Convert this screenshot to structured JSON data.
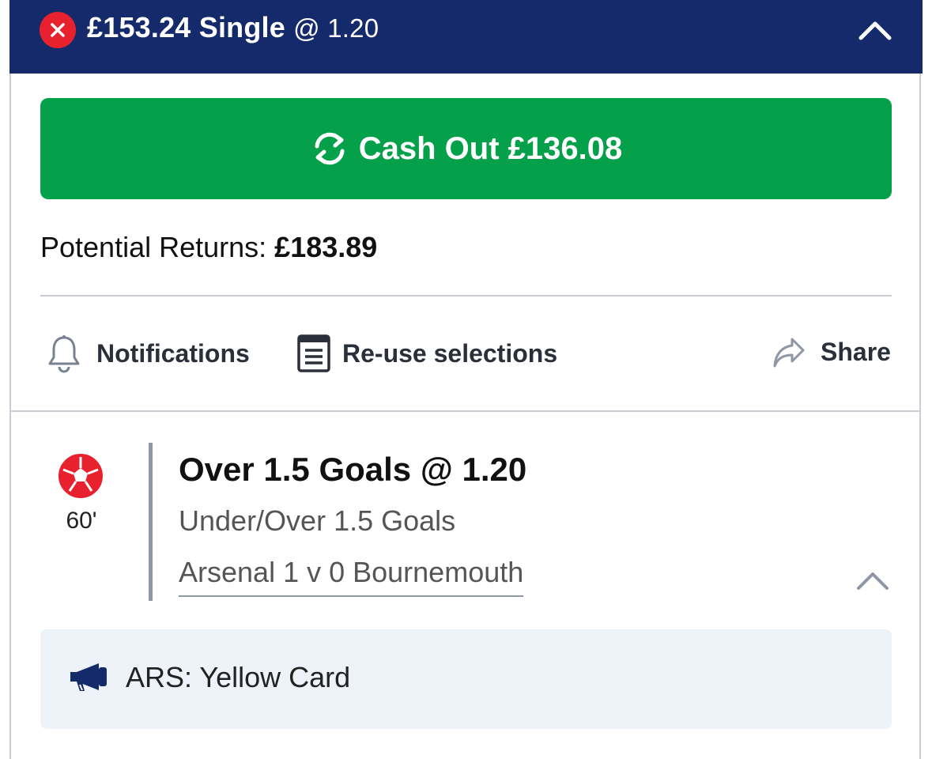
{
  "header": {
    "stake": "£153.24 Single",
    "odds": "@ 1.20",
    "close_icon": "close-icon",
    "collapse_icon": "chevron-up-icon"
  },
  "cashout": {
    "label": "Cash Out £136.08",
    "icon": "cashout-refresh-icon"
  },
  "returns": {
    "label": "Potential Returns:",
    "value": "£183.89"
  },
  "actions": {
    "notifications": "Notifications",
    "reuse": "Re-use selections",
    "share": "Share"
  },
  "selection": {
    "minute": "60'",
    "title": "Over 1.5 Goals @ 1.20",
    "market": "Under/Over 1.5 Goals",
    "event": "Arsenal 1 v 0 Bournemouth",
    "sport_icon": "football-icon"
  },
  "alert": {
    "text": "ARS: Yellow Card",
    "icon": "megaphone-icon"
  },
  "colors": {
    "header_bg": "#152a6b",
    "cashout_green": "#04a04a",
    "close_red": "#e8212e",
    "football_red": "#e8212e",
    "alert_bg": "#eef3fa"
  }
}
